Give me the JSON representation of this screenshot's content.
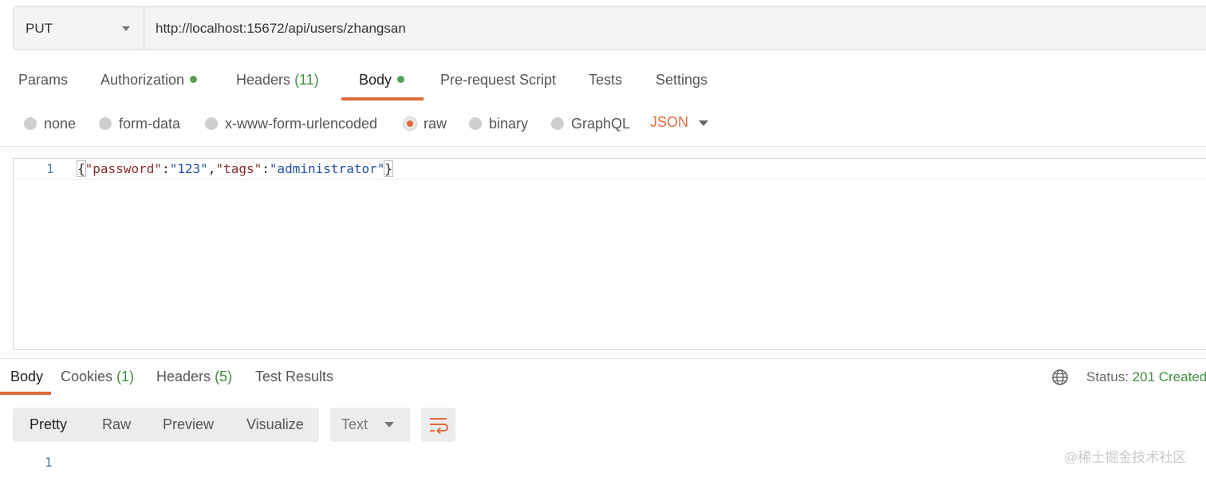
{
  "request": {
    "method": "PUT",
    "url": "http://localhost:15672/api/users/zhangsan"
  },
  "request_tabs": [
    {
      "label": "Params"
    },
    {
      "label": "Authorization"
    },
    {
      "label": "Headers",
      "count": "(11)"
    },
    {
      "label": "Body"
    },
    {
      "label": "Pre-request Script"
    },
    {
      "label": "Tests"
    },
    {
      "label": "Settings"
    }
  ],
  "active_request_tab": "Body",
  "body_types": [
    "none",
    "form-data",
    "x-www-form-urlencoded",
    "raw",
    "binary",
    "GraphQL"
  ],
  "selected_body_type": "raw",
  "body_language": "JSON",
  "editor": {
    "line_number": "1",
    "tokens": {
      "open": "{",
      "k1": "\"password\"",
      "c1": ":",
      "v1": "\"123\"",
      "comma": ",",
      "k2": "\"tags\"",
      "c2": ":",
      "v2": "\"administrator\"",
      "close": "}"
    }
  },
  "response_tabs": [
    {
      "label": "Body"
    },
    {
      "label": "Cookies",
      "count": "(1)"
    },
    {
      "label": "Headers",
      "count": "(5)"
    },
    {
      "label": "Test Results"
    }
  ],
  "status": {
    "label": "Status:",
    "value": "201 Created"
  },
  "view_modes": [
    "Pretty",
    "Raw",
    "Preview",
    "Visualize"
  ],
  "active_view_mode": "Pretty",
  "response_format": "Text",
  "response_line_number": "1",
  "watermark": "@稀土掘金技术社区",
  "colors": {
    "accent": "#e06b3c",
    "success": "#3f8f3f",
    "dot": "#58a05a"
  },
  "icons": {
    "method_dropdown": "chevron-down-icon",
    "globe": "globe-icon",
    "wrap": "wrap-lines-icon"
  }
}
